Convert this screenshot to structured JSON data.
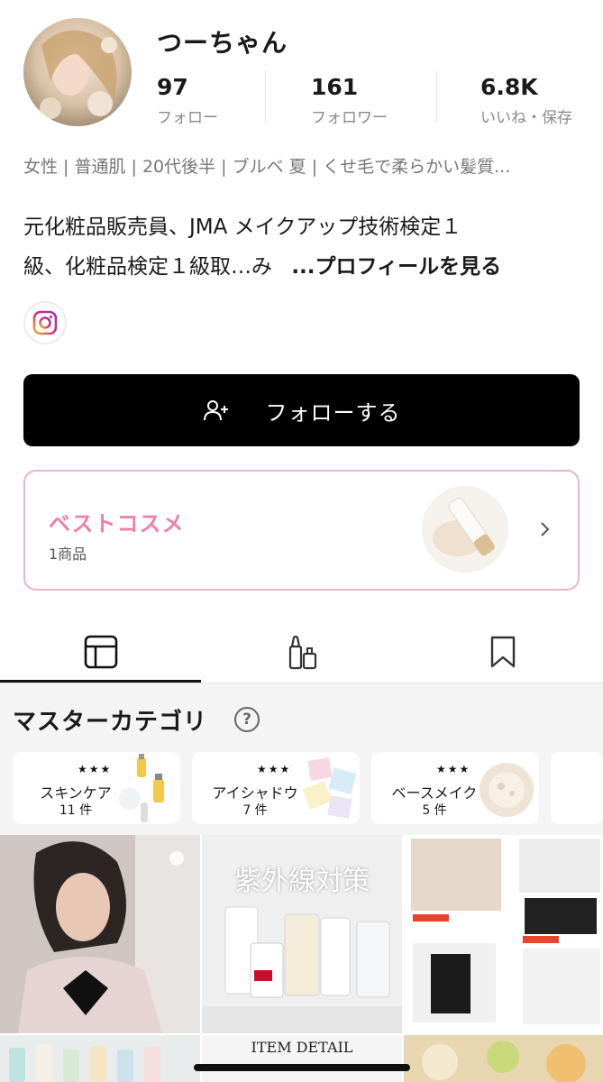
{
  "profile": {
    "username": "つーちゃん",
    "stats": [
      {
        "value": "97",
        "label": "フォロー"
      },
      {
        "value": "161",
        "label": "フォロワー"
      },
      {
        "value": "6.8K",
        "label": "いいね・保存"
      }
    ],
    "tags": "女性 | 普通肌 | 20代後半 | ブルベ 夏 | くせ毛で柔らかい髪質...",
    "bio_line1": "元化粧品販売員、JMA メイクアップ技術検定１",
    "bio_line2": "級、化粧品検定１級取…み",
    "bio_more": "...プロフィールを見る",
    "social_icon": "instagram-icon"
  },
  "follow_button": {
    "label": "フォローする",
    "icon": "add-user-icon"
  },
  "best_cosme": {
    "title": "ベストコスメ",
    "count": "1商品"
  },
  "tabs": [
    {
      "name": "posts",
      "icon": "grid-icon",
      "active": true
    },
    {
      "name": "items",
      "icon": "cosmetics-icon",
      "active": false
    },
    {
      "name": "saved",
      "icon": "bookmark-icon",
      "active": false
    }
  ],
  "master_category": {
    "title": "マスターカテゴリ",
    "items": [
      {
        "stars": "★★★",
        "name": "スキンケア",
        "count": "11 件"
      },
      {
        "stars": "★★★",
        "name": "アイシャドウ",
        "count": "7 件"
      },
      {
        "stars": "★★★",
        "name": "ベースメイク",
        "count": "5 件"
      }
    ]
  },
  "posts": [
    {
      "caption": ""
    },
    {
      "caption": "紫外線対策"
    },
    {
      "caption": ""
    },
    {
      "caption": ""
    },
    {
      "caption": "ITEM DETAIL"
    },
    {
      "caption": ""
    }
  ],
  "colors": {
    "accent_pink": "#ef7fa6",
    "card_border": "#f0b3c8",
    "button_bg": "#000000"
  }
}
